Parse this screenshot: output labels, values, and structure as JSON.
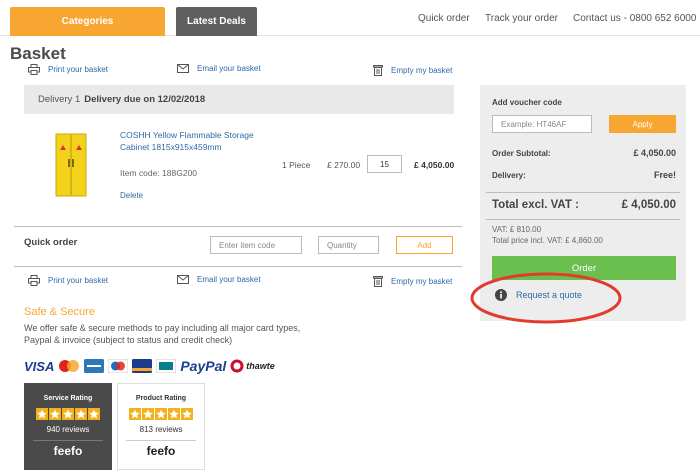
{
  "nav": {
    "categories": "Categories",
    "latest_deals": "Latest Deals",
    "quick_order": "Quick order",
    "track_order": "Track your order",
    "contact": "Contact us - 0800 652 6000"
  },
  "page_title": "Basket",
  "actions": {
    "print": "Print your basket",
    "email": "Email your basket",
    "empty": "Empty my basket"
  },
  "delivery": {
    "label": "Delivery 1",
    "due": "Delivery due on 12/02/2018"
  },
  "item": {
    "name": "COSHH Yellow Flammable Storage Cabinet 1815x915x459mm",
    "code": "Item code: 188G200",
    "delete": "Delete",
    "unit": "1 Piece",
    "price": "£ 270.00",
    "quantity": "15",
    "total": "£ 4,050.00"
  },
  "quick_order": {
    "label": "Quick order",
    "item_code_placeholder": "Enter item code",
    "quantity_placeholder": "Quantity",
    "add": "Add"
  },
  "summary": {
    "voucher_label": "Add voucher code",
    "voucher_placeholder": "Example: HT46AF",
    "apply": "Apply",
    "subtotal_label": "Order Subtotal:",
    "subtotal": "£ 4,050.00",
    "delivery_label": "Delivery:",
    "delivery": "Free!",
    "total_label": "Total excl. VAT :",
    "total": "£ 4,050.00",
    "vat": "VAT: £ 810.00",
    "total_incl": "Total price incl. VAT: £ 4,860.00",
    "order": "Order",
    "quote": "Request a quote"
  },
  "safe": {
    "title": "Safe & Secure",
    "text": "We offer safe & secure methods to pay including all major card types, Paypal & invoice (subject to status and credit check)"
  },
  "payments": [
    "VISA",
    "PayPal",
    "thawte"
  ],
  "ratings": {
    "service": {
      "title": "Service Rating",
      "count": "940 reviews",
      "stars": 5
    },
    "product": {
      "title": "Product Rating",
      "count": "813 reviews",
      "stars": 5
    },
    "brand": "feefo"
  },
  "colors": {
    "accent_orange": "#f7a731",
    "order_green": "#6bbf4e",
    "link_blue": "#2e6aa8",
    "annotation_red": "#e23b2e"
  }
}
